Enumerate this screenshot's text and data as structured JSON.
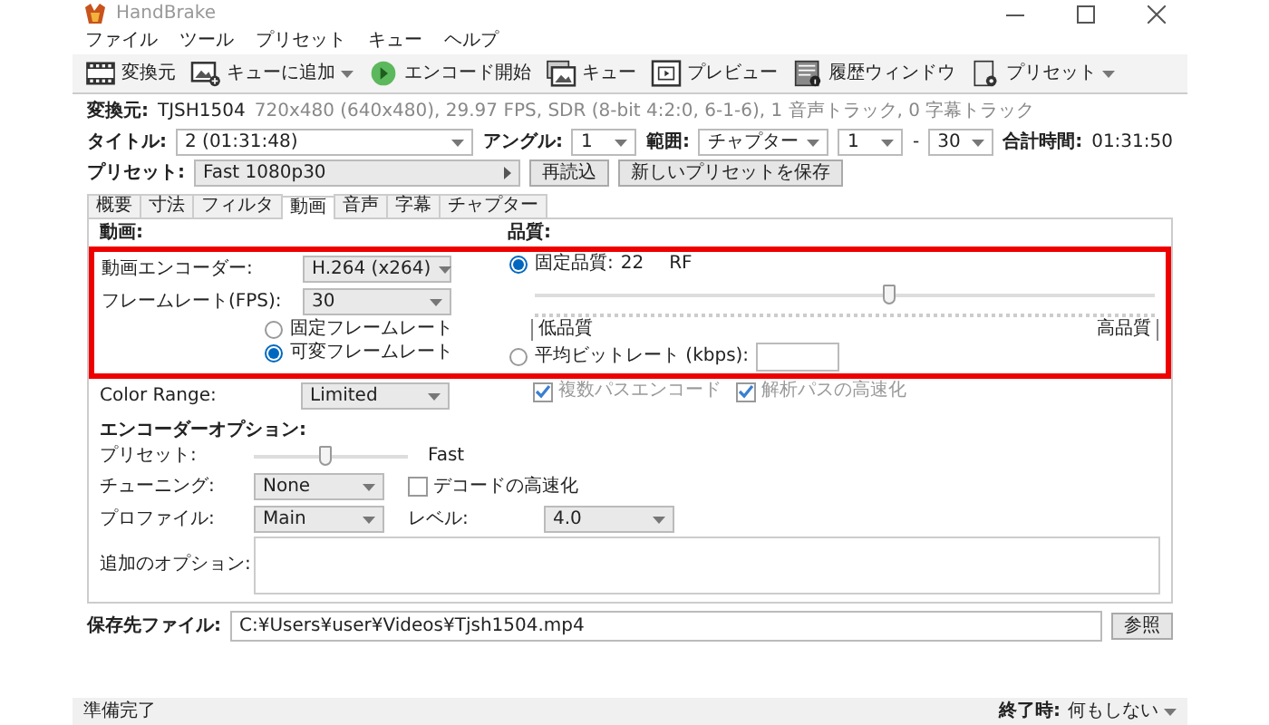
{
  "window": {
    "title": "HandBrake"
  },
  "menu": [
    {
      "label": "ファイル"
    },
    {
      "label": "ツール"
    },
    {
      "label": "プリセット"
    },
    {
      "label": "キュー"
    },
    {
      "label": "ヘルプ"
    }
  ],
  "toolbar": [
    {
      "kind": "source",
      "label": "変換元",
      "dropdown": false
    },
    {
      "kind": "add-queue",
      "label": "キューに追加",
      "dropdown": true
    },
    {
      "kind": "start",
      "label": "エンコード開始",
      "dropdown": false
    },
    {
      "kind": "queue",
      "label": "キュー",
      "dropdown": false
    },
    {
      "kind": "preview",
      "label": "プレビュー",
      "dropdown": false
    },
    {
      "kind": "activity",
      "label": "履歴ウィンドウ",
      "dropdown": false
    },
    {
      "kind": "presets",
      "label": "プリセット",
      "dropdown": true
    }
  ],
  "source": {
    "label": "変換元:",
    "name": "TJSH1504",
    "info": "720x480 (640x480), 29.97 FPS, SDR (8-bit 4:2:0, 6-1-6), 1 音声トラック, 0 字幕トラック"
  },
  "title_row": {
    "title_label": "タイトル:",
    "title": "2 (01:31:48)",
    "angle_label": "アングル:",
    "angle": "1",
    "range_label": "範囲:",
    "range_type": "チャプター",
    "range_start": "1",
    "range_sep": "-",
    "range_end": "30",
    "duration_label": "合計時間:",
    "duration": "01:31:50"
  },
  "preset_row": {
    "label": "プリセット:",
    "value": "Fast 1080p30",
    "buttons": [
      "再読込",
      "新しいプリセットを保存"
    ]
  },
  "tabs": [
    {
      "label": "概要",
      "selected": false
    },
    {
      "label": "寸法",
      "selected": false
    },
    {
      "label": "フィルタ",
      "selected": false
    },
    {
      "label": "動画",
      "selected": true
    },
    {
      "label": "音声",
      "selected": false
    },
    {
      "label": "字幕",
      "selected": false
    },
    {
      "label": "チャプター",
      "selected": false
    }
  ],
  "video": {
    "heading": "動画:",
    "encoder_label": "動画エンコーダー:",
    "encoder": "H.264 (x264)",
    "fps_label": "フレームレート(FPS):",
    "fps": "30",
    "fps_modes": [
      {
        "label": "固定フレームレート",
        "selected": false
      },
      {
        "label": "可変フレームレート",
        "selected": true
      }
    ],
    "color_range_label": "Color Range:",
    "color_range": "Limited"
  },
  "quality": {
    "heading": "品質:",
    "constant": {
      "label": "固定品質:",
      "selected": true,
      "value": "22",
      "unit": "RF",
      "level": 0.57
    },
    "low_label": "低品質",
    "high_label": "高品質",
    "bitrate": {
      "label": "平均ビットレート (kbps):",
      "selected": false
    },
    "options": [
      {
        "label": "複数パスエンコード",
        "checked": true,
        "disabled": true
      },
      {
        "label": "解析パスの高速化",
        "checked": true,
        "disabled": true
      }
    ]
  },
  "encoder_options": {
    "heading": "エンコーダーオプション:",
    "preset": {
      "label": "プリセット:",
      "level": 0.46,
      "value": "Fast"
    },
    "tune": {
      "label": "チューニング:",
      "value": "None"
    },
    "fast_decode": {
      "label": "デコードの高速化",
      "checked": false
    },
    "profile": {
      "label": "プロファイル:",
      "value": "Main"
    },
    "level_setting": {
      "label": "レベル:",
      "value": "4.0"
    },
    "extra": {
      "label": "追加のオプション:"
    }
  },
  "destination": {
    "label": "保存先ファイル:",
    "value": "C:¥Users¥user¥Videos¥Tjsh1504.mp4",
    "button": "参照"
  },
  "status_bar": {
    "status": "準備完了",
    "when_done_label": "終了時:",
    "when_done": "何もしない"
  }
}
